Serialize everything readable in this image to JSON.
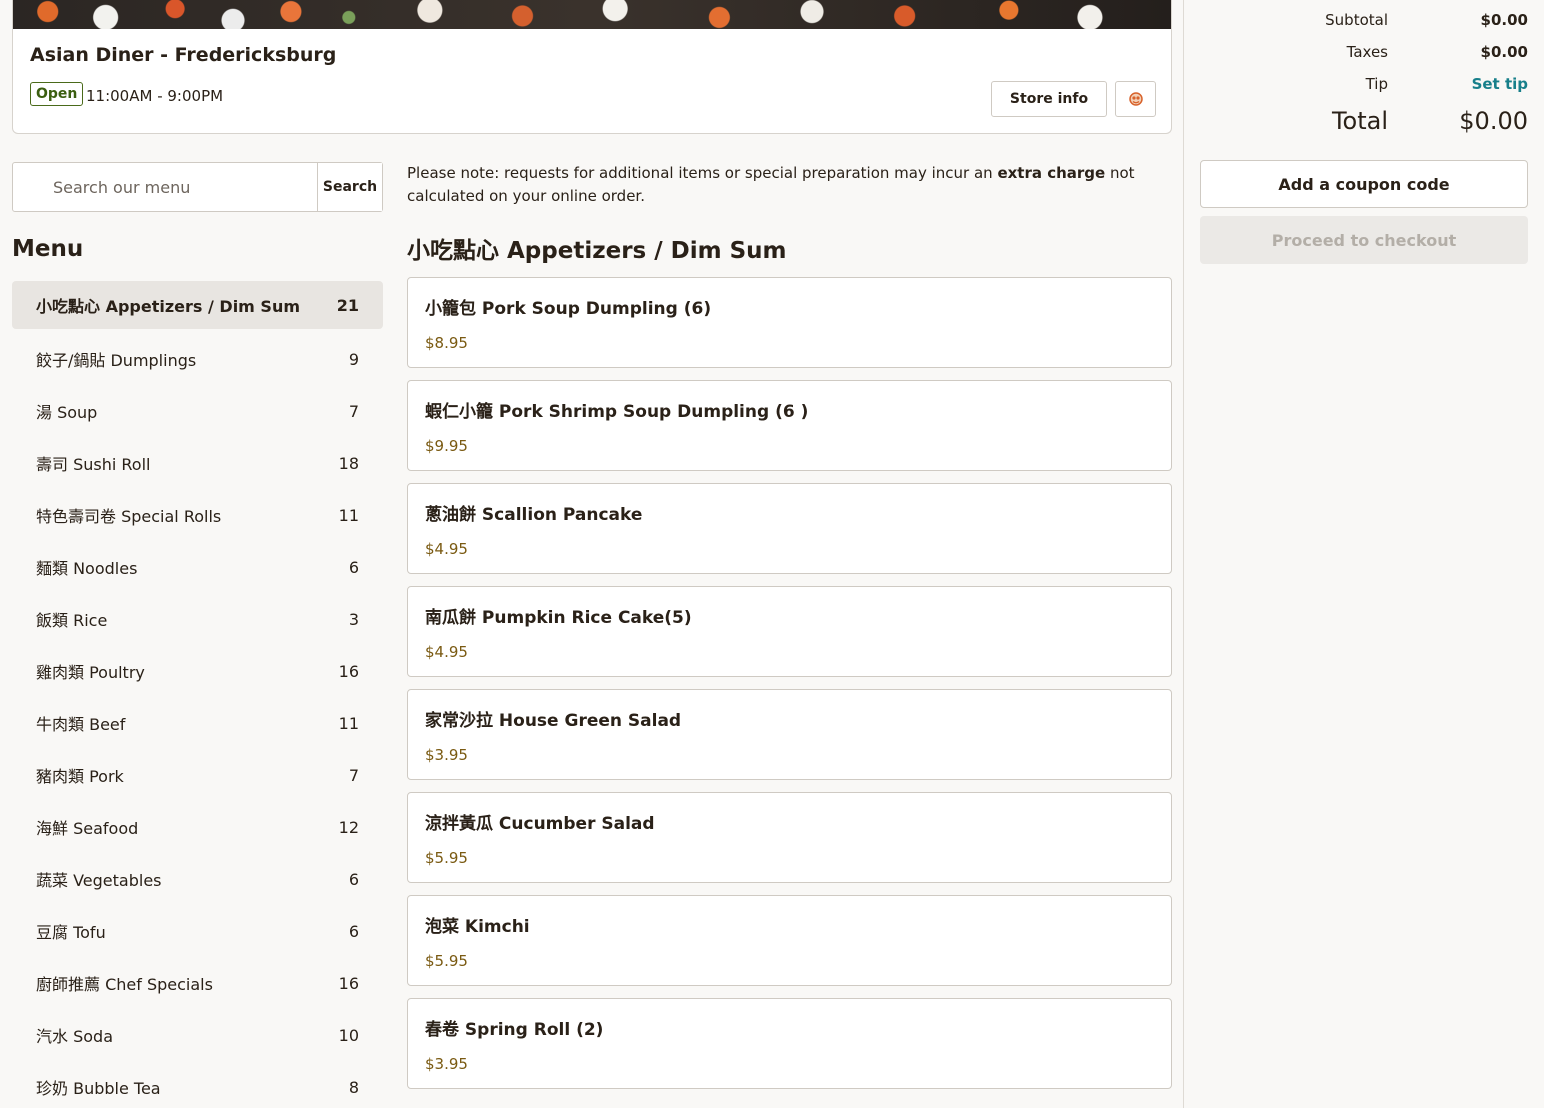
{
  "store": {
    "name": "Asian Diner - Fredericksburg",
    "status": "Open",
    "hours": "11:00AM - 9:00PM",
    "store_info_label": "Store info",
    "logo_icon": "restaurant-logo-icon"
  },
  "search": {
    "placeholder": "Search our menu",
    "button_label": "Search"
  },
  "menu": {
    "heading": "Menu",
    "categories": [
      {
        "label": "小吃點心 Appetizers / Dim Sum",
        "count": "21",
        "active": true
      },
      {
        "label": "餃子/鍋貼 Dumplings",
        "count": "9"
      },
      {
        "label": "湯 Soup",
        "count": "7"
      },
      {
        "label": "壽司 Sushi Roll",
        "count": "18"
      },
      {
        "label": "特色壽司卷 Special Rolls",
        "count": "11"
      },
      {
        "label": "麵類 Noodles",
        "count": "6"
      },
      {
        "label": "飯類 Rice",
        "count": "3"
      },
      {
        "label": "雞肉類 Poultry",
        "count": "16"
      },
      {
        "label": "牛肉類 Beef",
        "count": "11"
      },
      {
        "label": "豬肉類 Pork",
        "count": "7"
      },
      {
        "label": "海鮮 Seafood",
        "count": "12"
      },
      {
        "label": "蔬菜 Vegetables",
        "count": "6"
      },
      {
        "label": "豆腐 Tofu",
        "count": "6"
      },
      {
        "label": "廚師推薦 Chef Specials",
        "count": "16"
      },
      {
        "label": "汽水 Soda",
        "count": "10"
      },
      {
        "label": "珍奶 Bubble Tea",
        "count": "8"
      }
    ]
  },
  "note": {
    "prefix": "Please note: requests for additional items or special preparation may incur an ",
    "emphasis": "extra charge",
    "suffix": " not calculated on your online order."
  },
  "section": {
    "title": "小吃點心 Appetizers / Dim Sum",
    "items": [
      {
        "name": "小籠包 Pork Soup Dumpling (6)",
        "price": "$8.95"
      },
      {
        "name": "蝦仁小籠 Pork Shrimp Soup Dumpling (6 )",
        "price": "$9.95"
      },
      {
        "name": "蔥油餅 Scallion Pancake",
        "price": "$4.95"
      },
      {
        "name": "南瓜餅 Pumpkin Rice Cake(5)",
        "price": "$4.95"
      },
      {
        "name": "家常沙拉 House Green Salad",
        "price": "$3.95"
      },
      {
        "name": "涼拌黃瓜 Cucumber Salad",
        "price": "$5.95"
      },
      {
        "name": "泡菜 Kimchi",
        "price": "$5.95"
      },
      {
        "name": "春卷 Spring Roll (2)",
        "price": "$3.95"
      }
    ]
  },
  "cart": {
    "subtotal_label": "Subtotal",
    "subtotal_value": "$0.00",
    "taxes_label": "Taxes",
    "taxes_value": "$0.00",
    "tip_label": "Tip",
    "tip_action": "Set tip",
    "total_label": "Total",
    "total_value": "$0.00",
    "coupon_label": "Add a coupon code",
    "checkout_label": "Proceed to checkout"
  },
  "colors": {
    "accent_link": "#177f8a",
    "price": "#7a5a12",
    "open_badge": "#3b5e10"
  }
}
